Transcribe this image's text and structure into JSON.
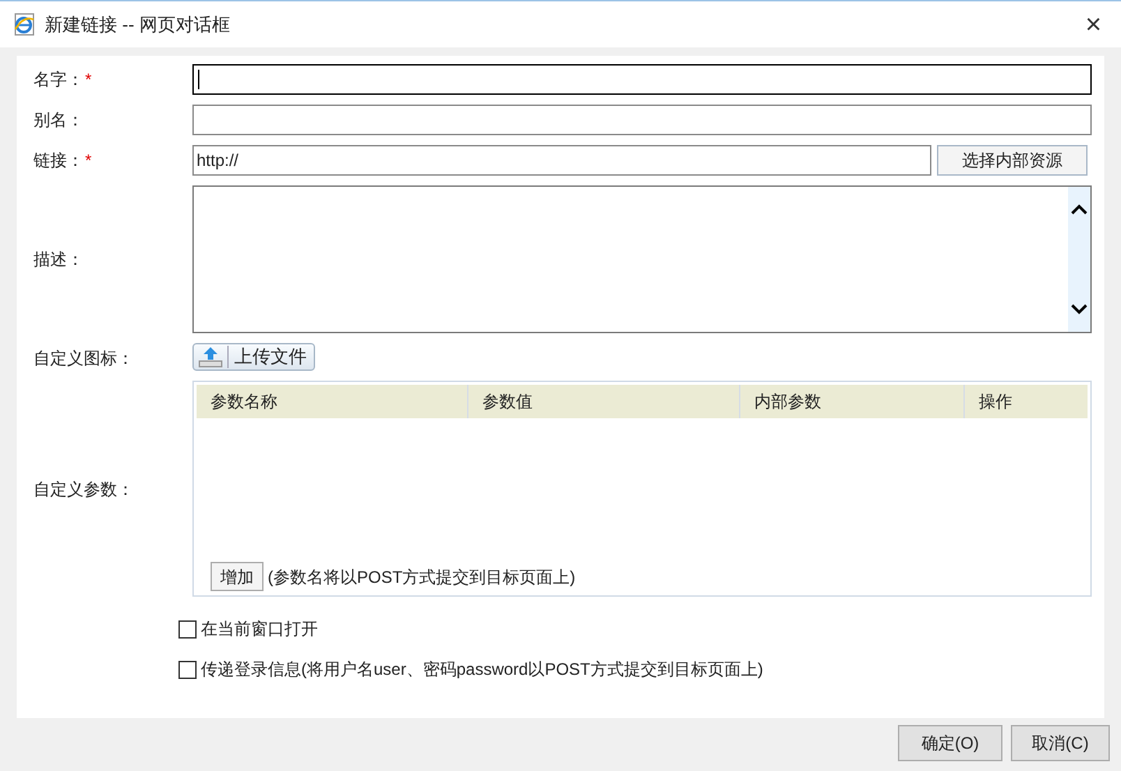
{
  "window": {
    "title": "新建链接 -- 网页对话框",
    "close": "×"
  },
  "fields": [
    {
      "kind": "input",
      "label": "名字：",
      "required_mark": "*",
      "focused": true
    },
    {
      "kind": "input",
      "label": "别名：",
      "focused": false
    },
    {
      "kind": "link",
      "label": "链接：",
      "required_mark": "*",
      "value": "http://",
      "focused": false,
      "button": "选择内部资源"
    },
    {
      "kind": "textarea",
      "label": "描述："
    },
    {
      "kind": "upload",
      "label": "自定义图标：",
      "button": "上传文件"
    },
    {
      "kind": "params",
      "label": "自定义参数：",
      "columns": [
        "参数名称",
        "参数值",
        "内部参数",
        "操作"
      ],
      "add_button": "增加",
      "note": "(参数名将以POST方式提交到目标页面上)"
    }
  ],
  "options": [
    {
      "label": "在当前窗口打开",
      "checked": false
    },
    {
      "label": "传递登录信息(将用户名user、密码password以POST方式提交到目标页面上)",
      "checked": false
    }
  ],
  "buttons": [
    "确定(O)",
    "取消(C)"
  ]
}
